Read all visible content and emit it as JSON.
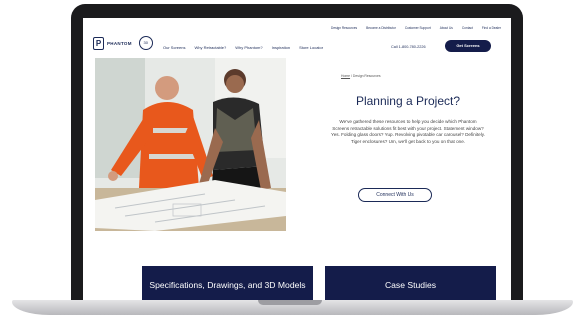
{
  "utility_nav": [
    "Design Resources",
    "Become a Distributor",
    "Customer Support",
    "About Us",
    "Contact",
    "Find a Dealer"
  ],
  "logo": {
    "mark": "P",
    "text": "PHANTOM",
    "badge": "30"
  },
  "main_nav": [
    "Our Screens",
    "Why Retractable?",
    "Why Phantom?",
    "Inspiration",
    "Store Locator"
  ],
  "phone": "Call 1-800-780-2226",
  "cta": "Get Screens",
  "breadcrumb": {
    "home": "Home",
    "separator": "/",
    "current": "Design Resources"
  },
  "hero": {
    "title": "Planning a Project?",
    "body": "We've gathered these resources to help you decide which Phantom Screens retractable solutions fit best with your project. Statement window? Yes. Folding glass doors? Yup. Revolving pivotable car carousel? Definitely. Tiger enclosures? Um, we'll get back to you on that one.",
    "button": "Connect With Us"
  },
  "cards": [
    {
      "label": "Specifications, Drawings, and 3D Models"
    },
    {
      "label": "Case Studies"
    }
  ],
  "colors": {
    "navy": "#141c4a",
    "accent_orange": "#e8581c",
    "frame": "#1b1b1d"
  }
}
